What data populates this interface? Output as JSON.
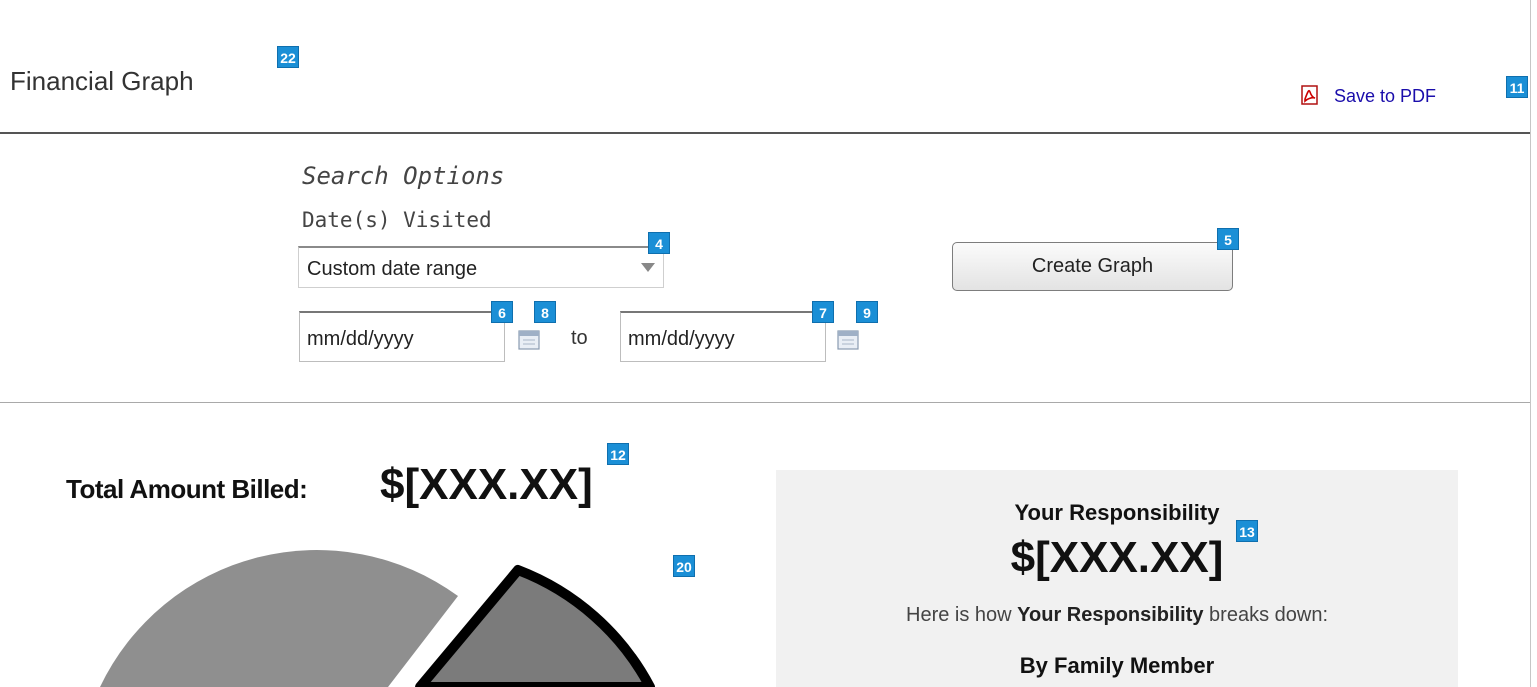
{
  "header": {
    "title": "Financial Graph",
    "save_pdf_label": "Save to PDF",
    "pdf_icon": "pdf-file-icon"
  },
  "search": {
    "section_title": "Search Options",
    "dates_label": "Date(s) Visited",
    "date_range_selected": "Custom date range",
    "from_placeholder": "mm/dd/yyyy",
    "to_label": "to",
    "to_placeholder": "mm/dd/yyyy",
    "calendar_icon": "calendar-icon",
    "create_button_label": "Create Graph"
  },
  "summary": {
    "total_label": "Total Amount Billed:",
    "total_amount": "$[XXX.XX]"
  },
  "responsibility": {
    "title": "Your Responsibility",
    "amount": "$[XXX.XX]",
    "desc_prefix": "Here is how ",
    "desc_bold": "Your Responsibility",
    "desc_suffix": " breaks down:",
    "group_title": "By Family Member"
  },
  "annotations": {
    "title_tag": "22",
    "pdf_tag": "11",
    "select_tag": "4",
    "create_tag": "5",
    "from_tag": "6",
    "to_tag": "7",
    "cal_from_tag": "8",
    "cal_to_tag": "9",
    "total_tag": "12",
    "resp_tag": "13",
    "chart_tag": "20"
  },
  "colors": {
    "accent_tag": "#1b8fd6",
    "link": "#1a0dab",
    "panel_bg": "#f1f1f1",
    "pie_light": "#8f8f8f",
    "pie_dark": "#7b7b7b"
  }
}
